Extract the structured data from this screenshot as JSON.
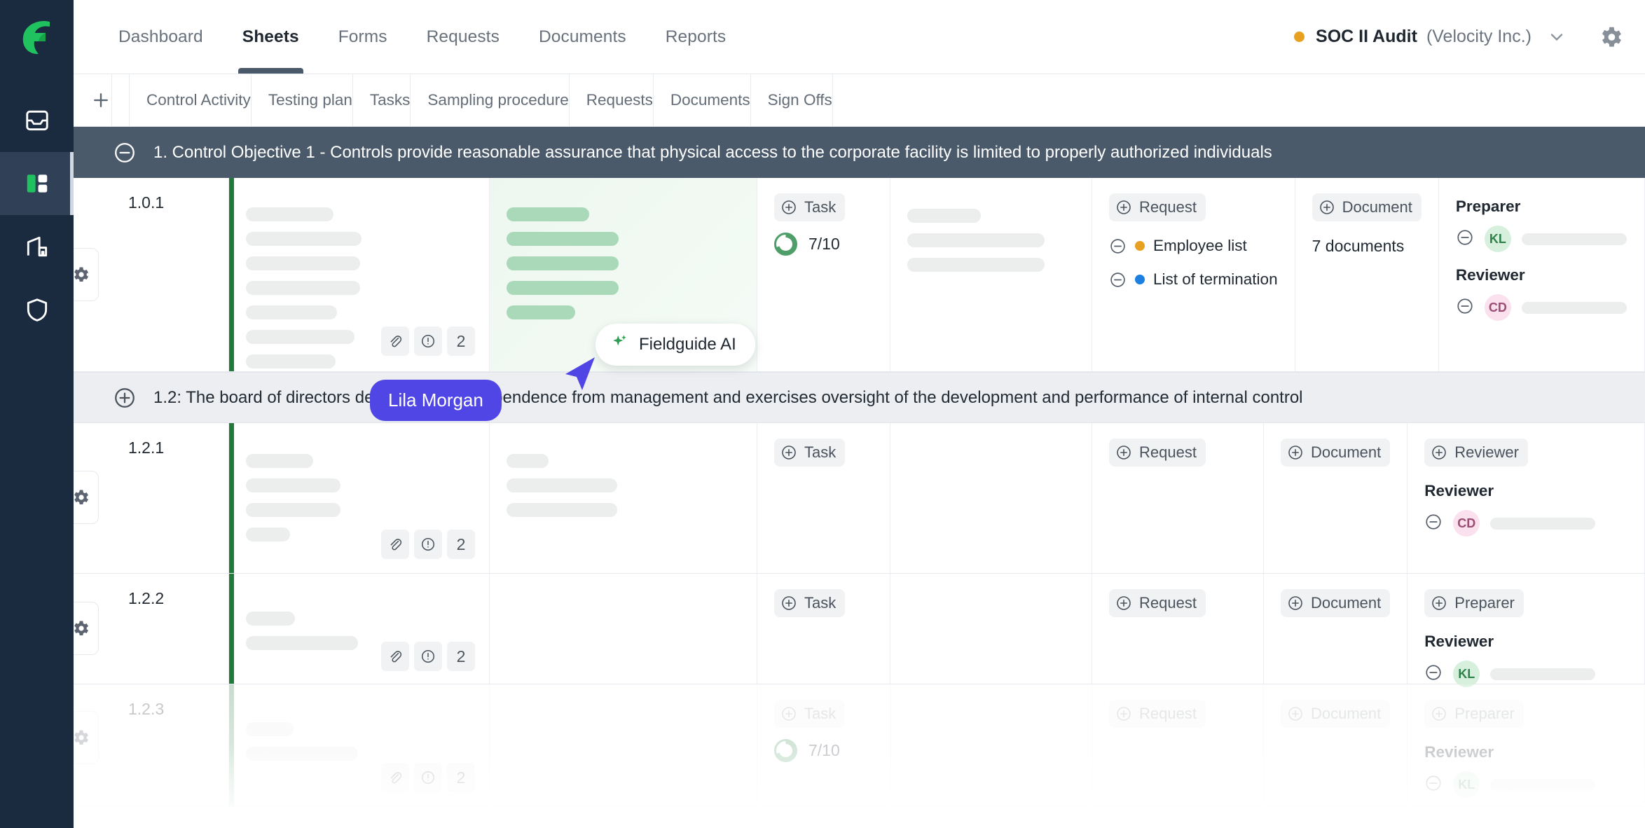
{
  "brand": {
    "logo_icon": "fieldguide-g-logo",
    "accent": "#20c25f",
    "rail_bg": "#1b2b3f"
  },
  "sidebar": {
    "items": [
      {
        "name": "inbox",
        "icon": "inbox-icon",
        "active": false
      },
      {
        "name": "sheets",
        "icon": "sheets-grid-icon",
        "active": true
      },
      {
        "name": "engagements",
        "icon": "building-icon",
        "active": false
      },
      {
        "name": "security",
        "icon": "shield-icon",
        "active": false
      }
    ]
  },
  "topnav": {
    "tabs": [
      {
        "label": "Dashboard",
        "active": false
      },
      {
        "label": "Sheets",
        "active": true
      },
      {
        "label": "Forms",
        "active": false
      },
      {
        "label": "Requests",
        "active": false
      },
      {
        "label": "Documents",
        "active": false
      },
      {
        "label": "Reports",
        "active": false
      }
    ],
    "project": {
      "status_color": "#e8a020",
      "name": "SOC II Audit",
      "org": "(Velocity Inc.)",
      "caret_icon": "chevron-down-icon"
    },
    "settings_icon": "gear-icon"
  },
  "table": {
    "add_column_label": "+",
    "columns": [
      {
        "key": "ref",
        "label": ""
      },
      {
        "key": "control_activity",
        "label": "Control Activity"
      },
      {
        "key": "testing_plan",
        "label": "Testing plan"
      },
      {
        "key": "tasks",
        "label": "Tasks"
      },
      {
        "key": "sampling_procedure",
        "label": "Sampling procedure"
      },
      {
        "key": "requests",
        "label": "Requests"
      },
      {
        "key": "documents",
        "label": "Documents"
      },
      {
        "key": "sign_offs",
        "label": "Sign Offs"
      }
    ]
  },
  "groups": [
    {
      "id": "g1",
      "style": "dark",
      "expanded": true,
      "toggle_icon": "minus-circle-icon",
      "title": "1. Control Objective 1 - Controls provide reasonable assurance that physical access to the corporate facility is limited to properly authorized individuals"
    },
    {
      "id": "g2",
      "style": "light",
      "expanded": false,
      "toggle_icon": "plus-circle-icon",
      "title": "1.2: The board of directors demonstrates independence from management and exercises oversight of the development and performance of internal control"
    }
  ],
  "rows": [
    {
      "ref": "1.0.1",
      "control_activity": {
        "skeleton_widths": [
          125,
          165,
          163,
          163,
          130,
          155,
          128
        ],
        "attachment_count": "2",
        "attach_icon": "paperclip-icon",
        "issue_icon": "exclamation-circle-icon"
      },
      "testing_plan": {
        "highlight": true,
        "skeleton_widths": [
          118,
          160,
          160,
          160,
          98
        ]
      },
      "tasks": {
        "add_label": "Task",
        "progress_label": "7/10",
        "progress_done": 7,
        "progress_total": 10
      },
      "sampling_procedure": {
        "skeleton_widths": [
          105,
          196,
          196
        ]
      },
      "requests": {
        "add_label": "Request",
        "items": [
          {
            "label": "Employee list",
            "status_color": "#e8a020",
            "remove_icon": "minus-circle-icon"
          },
          {
            "label": "List of termination",
            "status_color": "#1d7fe0",
            "remove_icon": "minus-circle-icon"
          }
        ]
      },
      "documents": {
        "add_label": "Document",
        "count_label": "7 documents"
      },
      "sign_offs": [
        {
          "role": "Preparer",
          "initials": "KL",
          "avatar_style": "green",
          "remove_icon": "minus-circle-icon"
        },
        {
          "role": "Reviewer",
          "initials": "CD",
          "avatar_style": "pink",
          "remove_icon": "minus-circle-icon"
        }
      ]
    },
    {
      "ref": "1.2.1",
      "control_activity": {
        "skeleton_widths": [
          96,
          135,
          135,
          63
        ],
        "attachment_count": "2",
        "attach_icon": "paperclip-icon",
        "issue_icon": "exclamation-circle-icon"
      },
      "testing_plan": {
        "highlight": false,
        "skeleton_widths": [
          60,
          158,
          158
        ]
      },
      "tasks": {
        "add_label": "Task"
      },
      "sampling_procedure": {},
      "requests": {
        "add_label": "Request",
        "items": []
      },
      "documents": {
        "add_label": "Document"
      },
      "sign_offs_add": "Reviewer",
      "sign_offs": [
        {
          "role": "Reviewer",
          "initials": "CD",
          "avatar_style": "pink",
          "remove_icon": "minus-circle-icon"
        }
      ]
    },
    {
      "ref": "1.2.2",
      "control_activity": {
        "skeleton_widths": [
          70,
          160
        ],
        "attachment_count": "2",
        "attach_icon": "paperclip-icon",
        "issue_icon": "exclamation-circle-icon"
      },
      "testing_plan": {
        "highlight": false,
        "skeleton_widths": []
      },
      "tasks": {
        "add_label": "Task"
      },
      "sampling_procedure": {},
      "requests": {
        "add_label": "Request",
        "items": []
      },
      "documents": {
        "add_label": "Document"
      },
      "sign_offs_add": "Preparer",
      "sign_offs": [
        {
          "role": "Reviewer",
          "initials": "KL",
          "avatar_style": "green",
          "remove_icon": "minus-circle-icon"
        }
      ]
    },
    {
      "ref": "1.2.3",
      "faded": true,
      "control_activity": {
        "skeleton_widths": [
          68,
          160
        ],
        "attachment_count": "2",
        "attach_icon": "paperclip-icon",
        "issue_icon": "exclamation-circle-icon"
      },
      "testing_plan": {
        "highlight": false,
        "skeleton_widths": []
      },
      "tasks": {
        "add_label": "Task",
        "progress_label": "7/10",
        "progress_done": 7,
        "progress_total": 10
      },
      "sampling_procedure": {},
      "requests": {
        "add_label": "Request",
        "items": []
      },
      "documents": {
        "add_label": "Document"
      },
      "sign_offs_add": "Preparer",
      "sign_offs": [
        {
          "role": "Reviewer",
          "initials": "KL",
          "avatar_style": "green",
          "remove_icon": "minus-circle-icon"
        }
      ]
    }
  ],
  "overlays": {
    "ai_badge": {
      "label": "Fieldguide AI",
      "icon": "sparkle-icon",
      "icon_color": "#2f9e52"
    },
    "collaborator_cursor": {
      "name": "Lila Morgan",
      "color": "#4f46e5",
      "icon": "cursor-arrow-icon"
    }
  }
}
